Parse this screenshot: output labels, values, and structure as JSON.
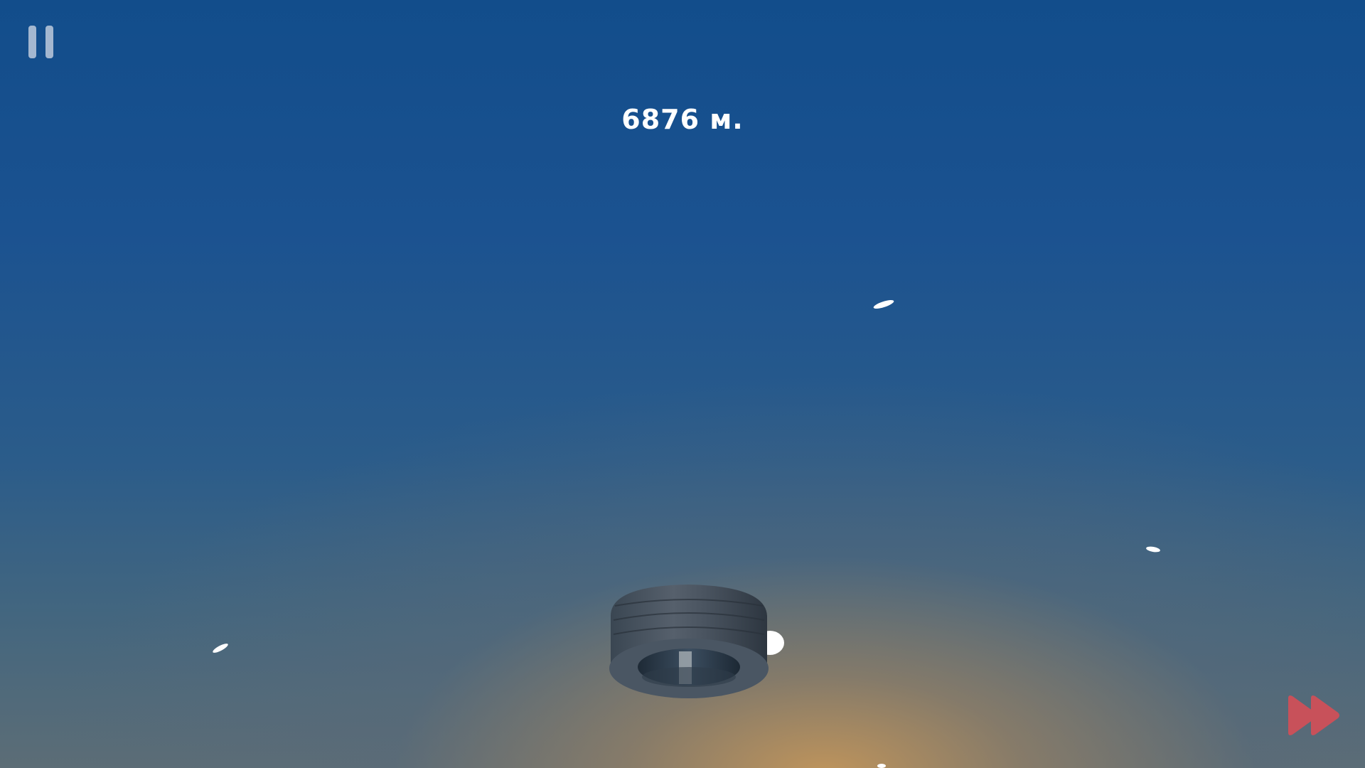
{
  "hud": {
    "distance_text": "6876 м.",
    "pause_icon": "pause-icon",
    "fast_forward_icon": "fast-forward-icon"
  },
  "colors": {
    "sky_top": "#124d8b",
    "sky_bottom_glow": "#c4965a",
    "fast_forward": "#c8515a",
    "pause": "#c8d2e1"
  },
  "scene": {
    "player": "tire",
    "particles": "white-feathers"
  }
}
